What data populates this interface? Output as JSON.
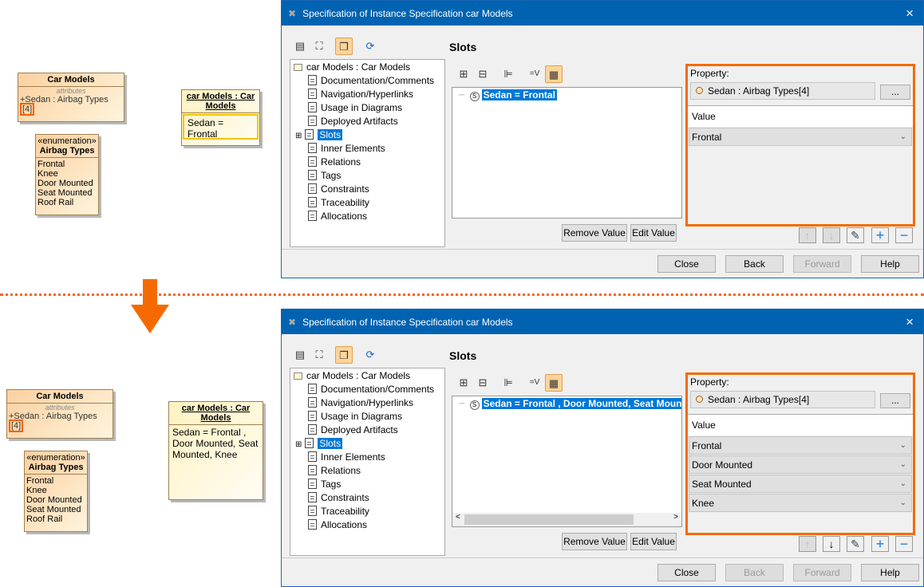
{
  "colors": {
    "accent": "#f56a00",
    "titlebar": "#0063b1",
    "selection": "#0078d7"
  },
  "before": {
    "class": {
      "name": "Car Models",
      "compartment": "attributes",
      "attribute": "+Sedan : Airbag Types",
      "multiplicity": "[4]"
    },
    "enum": {
      "stereotype": "«enumeration»",
      "name": "Airbag Types",
      "literals": [
        "Frontal",
        "Knee",
        "Door Mounted",
        "Seat Mounted",
        "Roof Rail"
      ]
    },
    "instance": {
      "name": "car Models : Car Models",
      "slot": "Sedan = Frontal"
    }
  },
  "after": {
    "class": {
      "name": "Car Models",
      "compartment": "attributes",
      "attribute": "+Sedan : Airbag Types",
      "multiplicity": "[4]"
    },
    "enum": {
      "stereotype": "«enumeration»",
      "name": "Airbag Types",
      "literals": [
        "Frontal",
        "Knee",
        "Door Mounted",
        "Seat Mounted",
        "Roof Rail"
      ]
    },
    "instance": {
      "name": "car Models : Car Models",
      "slot": "Sedan = Frontal , Door Mounted, Seat Mounted, Knee"
    }
  },
  "dialogs": [
    {
      "title": "Specification of Instance Specification car Models",
      "close_icon": "×",
      "section": "Slots",
      "tree": {
        "root": "car Models : Car Models",
        "items": [
          "Documentation/Comments",
          "Navigation/Hyperlinks",
          "Usage in Diagrams",
          "Deployed Artifacts",
          "Slots",
          "Inner Elements",
          "Relations",
          "Tags",
          "Constraints",
          "Traceability",
          "Allocations"
        ]
      },
      "slot": "Sedan = Frontal",
      "remove_value": "Remove Value",
      "edit_value": "Edit Value",
      "property_label": "Property:",
      "property": "Sedan : Airbag Types[4]",
      "browse": "...",
      "value_header": "Value",
      "values": [
        "Frontal"
      ],
      "buttons": {
        "close": "Close",
        "back": "Back",
        "forward": "Forward",
        "help": "Help"
      },
      "back_enabled": true,
      "down_enabled": false
    },
    {
      "title": "Specification of Instance Specification car Models",
      "close_icon": "×",
      "section": "Slots",
      "tree": {
        "root": "car Models : Car Models",
        "items": [
          "Documentation/Comments",
          "Navigation/Hyperlinks",
          "Usage in Diagrams",
          "Deployed Artifacts",
          "Slots",
          "Inner Elements",
          "Relations",
          "Tags",
          "Constraints",
          "Traceability",
          "Allocations"
        ]
      },
      "slot": "Sedan = Frontal , Door Mounted, Seat Mounted, Knee",
      "remove_value": "Remove Value",
      "edit_value": "Edit Value",
      "property_label": "Property:",
      "property": "Sedan : Airbag Types[4]",
      "browse": "...",
      "value_header": "Value",
      "values": [
        "Frontal",
        "Door Mounted",
        "Seat Mounted",
        "Knee"
      ],
      "buttons": {
        "close": "Close",
        "back": "Back",
        "forward": "Forward",
        "help": "Help"
      },
      "back_enabled": false,
      "down_enabled": true
    }
  ]
}
